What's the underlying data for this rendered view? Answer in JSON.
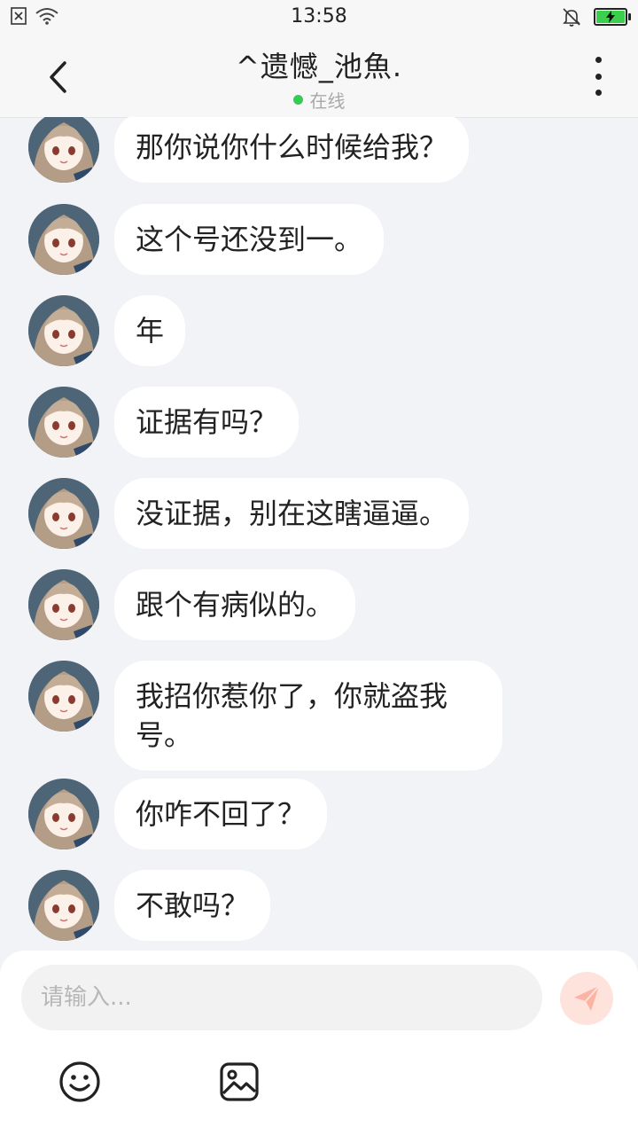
{
  "status_bar": {
    "time": "13:58",
    "icons": [
      "no-sim-icon",
      "wifi-icon",
      "mute-bell-icon",
      "battery-charging-icon"
    ],
    "battery_color": "#3ccf4e"
  },
  "header": {
    "title": "^遗憾_池魚.",
    "status": "在线",
    "status_color": "#33cc55"
  },
  "messages": [
    {
      "text": "那你说你什么时候给我？"
    },
    {
      "text": "这个号还没到一。"
    },
    {
      "text": "年"
    },
    {
      "text": "证据有吗？"
    },
    {
      "text": "没证据，别在这瞎逼逼。"
    },
    {
      "text": "跟个有病似的。"
    },
    {
      "text": "我招你惹你了，你就盗我号。"
    },
    {
      "text": "你咋不回了？"
    },
    {
      "text": "不敢吗？"
    }
  ],
  "composer": {
    "placeholder": "请输入...",
    "send_icon": "paper-plane-icon",
    "tools": [
      "emoji-icon",
      "image-icon"
    ],
    "send_color": "#f7735a"
  }
}
